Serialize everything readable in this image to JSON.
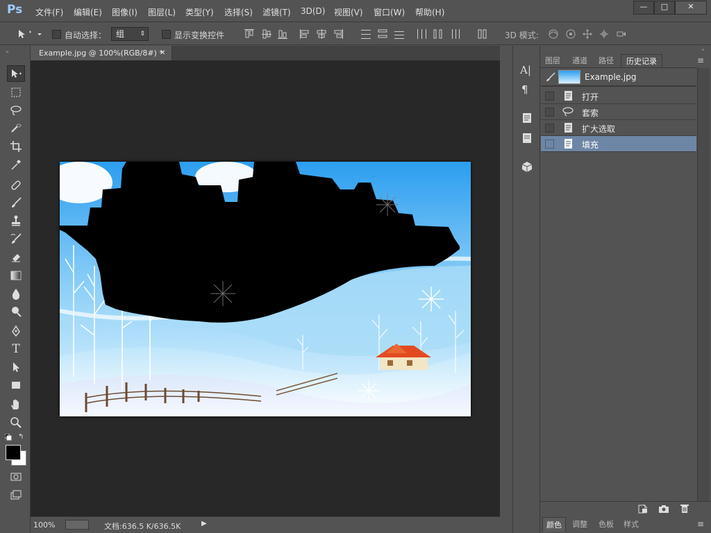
{
  "app": {
    "logo": "Ps"
  },
  "menu": [
    "文件(F)",
    "编辑(E)",
    "图像(I)",
    "图层(L)",
    "类型(Y)",
    "选择(S)",
    "滤镜(T)",
    "3D(D)",
    "视图(V)",
    "窗口(W)",
    "帮助(H)"
  ],
  "window_buttons": {
    "minimize": "—",
    "maximize": "□",
    "close": "✕"
  },
  "options": {
    "auto_select_label": "自动选择：",
    "auto_select_value": "组",
    "show_transform_label": "显示变换控件",
    "mode_3d_label": "3D 模式:"
  },
  "document": {
    "tab_title": "Example.jpg @ 100%(RGB/8#) *",
    "close_glyph": "✕"
  },
  "status": {
    "zoom": "100%",
    "doc_info": "文档:636.5 K/636.5K"
  },
  "panel_tabs": [
    "图层",
    "通道",
    "路径",
    "历史记录"
  ],
  "history": {
    "snapshot_name": "Example.jpg",
    "steps": [
      {
        "label": "打开",
        "icon": "document-icon",
        "active": false
      },
      {
        "label": "套索",
        "icon": "lasso-icon",
        "active": false
      },
      {
        "label": "扩大选取",
        "icon": "document-icon",
        "active": false
      },
      {
        "label": "填充",
        "icon": "document-icon",
        "active": true
      }
    ]
  },
  "bottom_tabs": [
    "颜色",
    "调整",
    "色板",
    "样式"
  ],
  "colors": {
    "accent": "#6e86a6",
    "canvas_bg": "#282828",
    "ui_bg": "#535353"
  }
}
